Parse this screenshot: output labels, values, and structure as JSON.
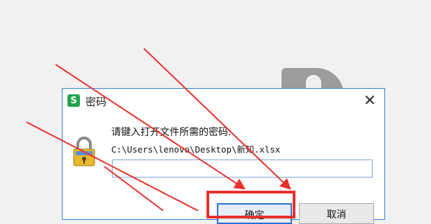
{
  "dialog": {
    "title": "密码",
    "app_icon_letter": "S",
    "close_symbol": "✕",
    "prompt": "请键入打开文件所需的密码:",
    "file_path": "C:\\Users\\lenovo\\Desktop\\新知.xlsx",
    "password_value": "",
    "ok_label": "确定",
    "cancel_label": "取消"
  },
  "colors": {
    "accent_border": "#2b7fd6",
    "annotation_red": "#e8302c",
    "app_icon_green": "#22a34a"
  },
  "icons": [
    "app-icon",
    "close-icon",
    "lock-icon"
  ]
}
